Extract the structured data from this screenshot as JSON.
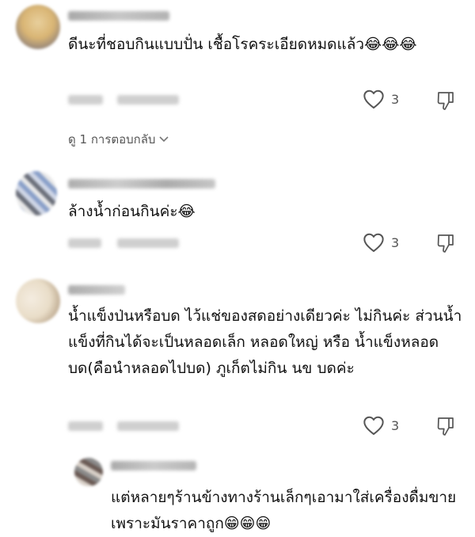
{
  "comments": [
    {
      "text": "ดีนะที่ชอบกินแบบปั่น เชื้อโรคระเอียดหมดแล้ว😂😂😂",
      "likes": "3",
      "replies_label": "ดู 1 การตอบกลับ"
    },
    {
      "text": "ล้างน้ำก่อนกินค่ะ😂",
      "likes": "3"
    },
    {
      "text": "น้ำแข็งป่นหรือบด ไว้แช่ของสดอย่างเดียวค่ะ ไม่กินค่ะ ส่วนน้ำแข็งที่กินได้จะเป็นหลอดเล็ก หลอดใหญ่ หรือ น้ำแข็งหลอดบด(คือนำหลอดไปบด) ภูเก็ตไม่กิน นข บดค่ะ",
      "likes": "3"
    },
    {
      "text": "แต่หลายๆร้านข้างทางร้านเล็กๆเอามาใส่เครื่องดื่มขายเพราะมันราคาถูก😁😁😁"
    }
  ],
  "icons": {
    "like": "heart-outline-icon",
    "dislike": "thumbs-down-outline-icon",
    "expand": "chevron-down-icon"
  }
}
